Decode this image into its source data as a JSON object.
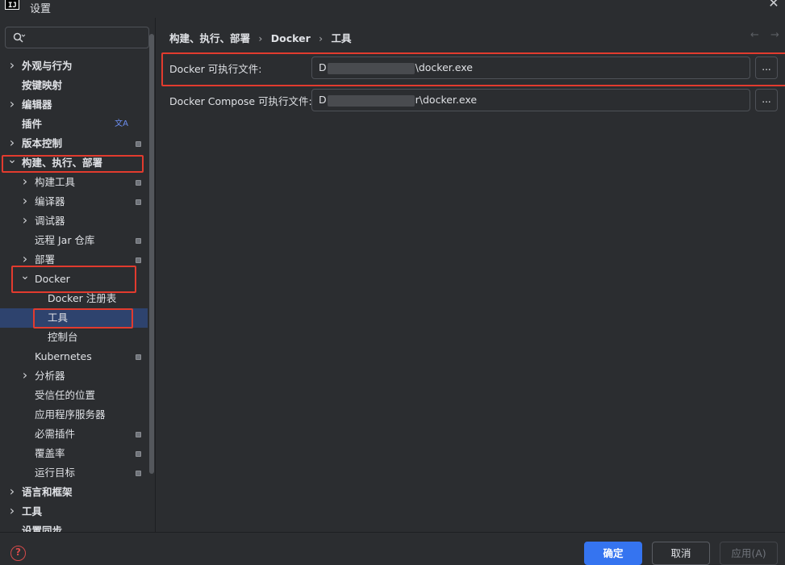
{
  "window": {
    "logo_text": "IJ",
    "title": "设置"
  },
  "search": {
    "placeholder": ""
  },
  "tree": [
    {
      "label": "外观与行为",
      "level": 0,
      "arrow": "right",
      "bold": true,
      "badge": false
    },
    {
      "label": "按键映射",
      "level": 0,
      "arrow": "",
      "bold": true,
      "badge": false
    },
    {
      "label": "编辑器",
      "level": 0,
      "arrow": "right",
      "bold": true,
      "badge": false
    },
    {
      "label": "插件",
      "level": 0,
      "arrow": "",
      "bold": true,
      "badge": false,
      "translate": true
    },
    {
      "label": "版本控制",
      "level": 0,
      "arrow": "right",
      "bold": true,
      "badge": true
    },
    {
      "label": "构建、执行、部署",
      "level": 0,
      "arrow": "down",
      "bold": true,
      "badge": false
    },
    {
      "label": "构建工具",
      "level": 1,
      "arrow": "right",
      "bold": false,
      "badge": true
    },
    {
      "label": "编译器",
      "level": 1,
      "arrow": "right",
      "bold": false,
      "badge": true
    },
    {
      "label": "调试器",
      "level": 1,
      "arrow": "right",
      "bold": false,
      "badge": false
    },
    {
      "label": "远程 Jar 仓库",
      "level": 1,
      "arrow": "",
      "bold": false,
      "badge": true
    },
    {
      "label": "部署",
      "level": 1,
      "arrow": "right",
      "bold": false,
      "badge": true
    },
    {
      "label": "Docker",
      "level": 1,
      "arrow": "down",
      "bold": false,
      "badge": false
    },
    {
      "label": "Docker 注册表",
      "level": 2,
      "arrow": "",
      "bold": false,
      "badge": false
    },
    {
      "label": "工具",
      "level": 2,
      "arrow": "",
      "bold": false,
      "badge": false,
      "selected": true
    },
    {
      "label": "控制台",
      "level": 2,
      "arrow": "",
      "bold": false,
      "badge": false
    },
    {
      "label": "Kubernetes",
      "level": 1,
      "arrow": "",
      "bold": false,
      "badge": true
    },
    {
      "label": "分析器",
      "level": 1,
      "arrow": "right",
      "bold": false,
      "badge": false
    },
    {
      "label": "受信任的位置",
      "level": 1,
      "arrow": "",
      "bold": false,
      "badge": false
    },
    {
      "label": "应用程序服务器",
      "level": 1,
      "arrow": "",
      "bold": false,
      "badge": false
    },
    {
      "label": "必需插件",
      "level": 1,
      "arrow": "",
      "bold": false,
      "badge": true
    },
    {
      "label": "覆盖率",
      "level": 1,
      "arrow": "",
      "bold": false,
      "badge": true
    },
    {
      "label": "运行目标",
      "level": 1,
      "arrow": "",
      "bold": false,
      "badge": true
    },
    {
      "label": "语言和框架",
      "level": 0,
      "arrow": "right",
      "bold": true,
      "badge": false
    },
    {
      "label": "工具",
      "level": 0,
      "arrow": "right",
      "bold": true,
      "badge": false
    },
    {
      "label": "设置同步",
      "level": 0,
      "arrow": "",
      "bold": true,
      "badge": false
    }
  ],
  "breadcrumb": [
    "构建、执行、部署",
    "Docker",
    "工具"
  ],
  "form": {
    "docker_label": "Docker 可执行文件:",
    "docker_value_start": "D",
    "docker_value_end": "\\docker.exe",
    "compose_label": "Docker Compose 可执行文件:",
    "compose_value_start": "D",
    "compose_value_end": "r\\docker.exe",
    "browse_label": "..."
  },
  "footer": {
    "help_label": "?",
    "ok_label": "确定",
    "cancel_label": "取消",
    "apply_label": "应用(A)"
  },
  "colors": {
    "accent": "#3574f0",
    "highlight": "#e23b2e",
    "selection": "#2e436e"
  },
  "icons": {
    "search": "search-icon",
    "close": "close-icon",
    "back": "arrow-left-icon",
    "forward": "arrow-right-icon",
    "help": "help-icon",
    "translate": "translate-icon"
  }
}
